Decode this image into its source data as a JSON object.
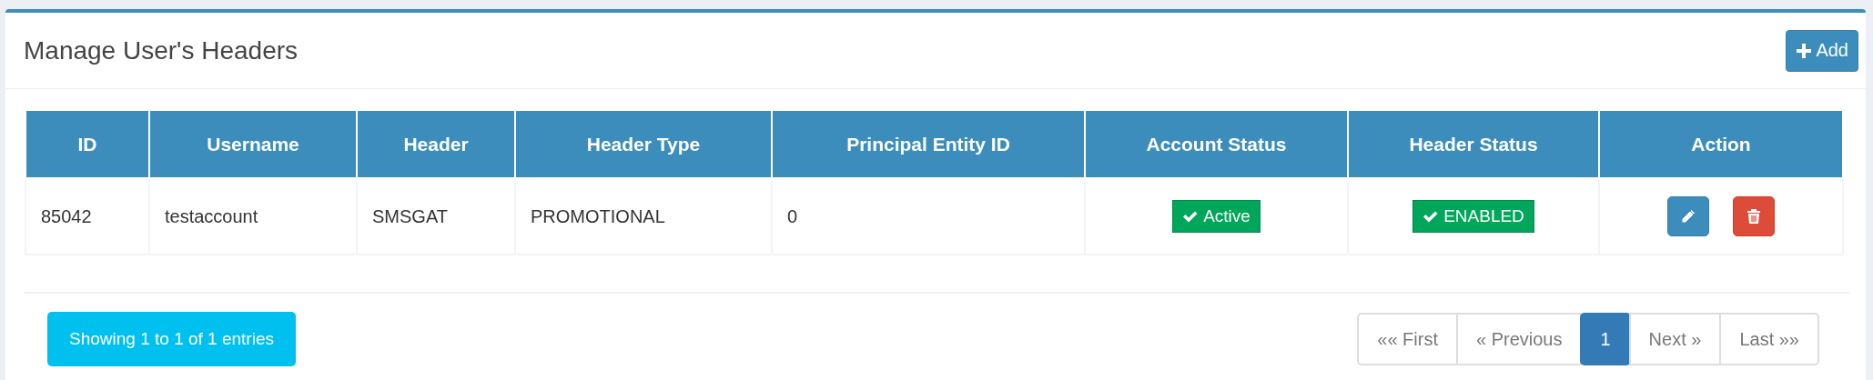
{
  "title": "Manage User's Headers",
  "add_button": {
    "label": "Add"
  },
  "table": {
    "columns": [
      "ID",
      "Username",
      "Header",
      "Header Type",
      "Principal Entity ID",
      "Account Status",
      "Header Status",
      "Action"
    ],
    "rows": [
      {
        "id": "85042",
        "username": "testaccount",
        "header": "SMSGAT",
        "header_type": "PROMOTIONAL",
        "principal_entity_id": "0",
        "account_status": {
          "label": "Active",
          "kind": "success"
        },
        "header_status": {
          "label": "ENABLED",
          "kind": "success"
        },
        "actions": [
          {
            "kind": "edit"
          },
          {
            "kind": "delete"
          }
        ]
      }
    ]
  },
  "info": "Showing 1 to 1 of 1 entries",
  "pagination": [
    {
      "label": "«« First",
      "selected": false
    },
    {
      "label": "« Previous",
      "selected": false
    },
    {
      "label": "1",
      "selected": true
    },
    {
      "label": "Next »",
      "selected": false
    },
    {
      "label": "Last »»",
      "selected": false
    }
  ]
}
